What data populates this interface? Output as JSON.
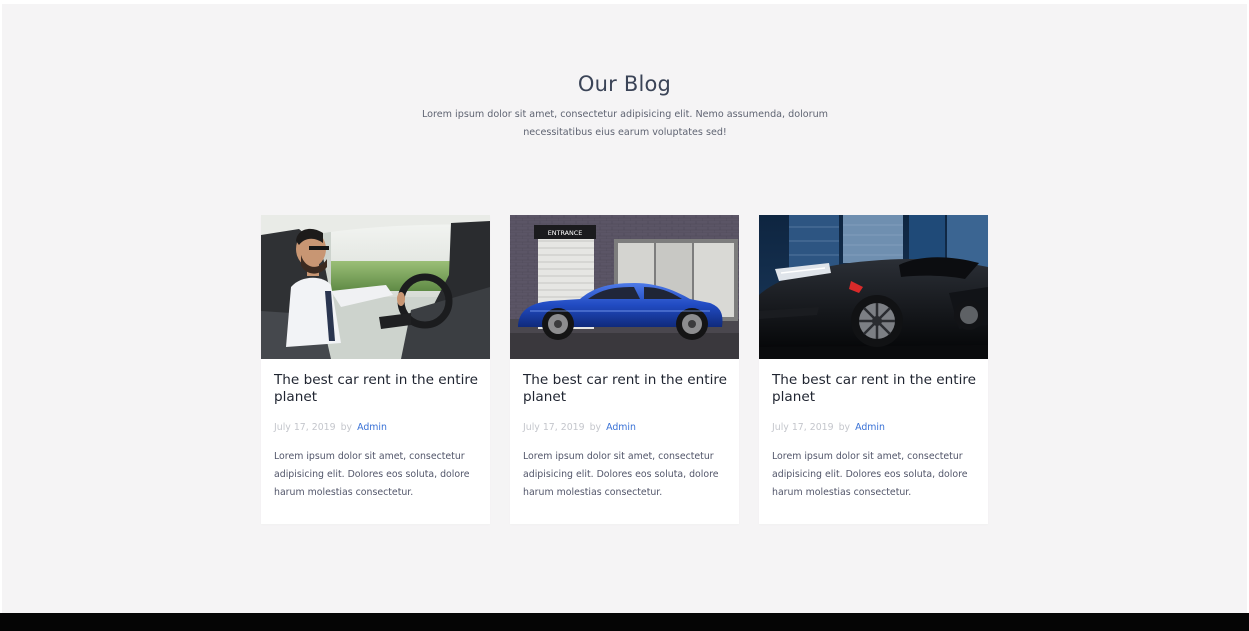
{
  "section": {
    "title": "Our Blog",
    "subtitle": "Lorem ipsum dolor sit amet, consectetur adipisicing elit. Nemo assumenda, dolorum necessitatibus eius earum voluptates sed!"
  },
  "posts": [
    {
      "title": "The best car rent in the entire planet",
      "date": "July 17, 2019",
      "by": "by",
      "author": "Admin",
      "excerpt": "Lorem ipsum dolor sit amet, consectetur adipisicing elit. Dolores eos soluta, dolore harum molestias consectetur.",
      "image_label": ""
    },
    {
      "title": "The best car rent in the entire planet",
      "date": "July 17, 2019",
      "by": "by",
      "author": "Admin",
      "excerpt": "Lorem ipsum dolor sit amet, consectetur adipisicing elit. Dolores eos soluta, dolore harum molestias consectetur.",
      "image_label": "ENTRANCE"
    },
    {
      "title": "The best car rent in the entire planet",
      "date": "July 17, 2019",
      "by": "by",
      "author": "Admin",
      "excerpt": "Lorem ipsum dolor sit amet, consectetur adipisicing elit. Dolores eos soluta, dolore harum molestias consectetur.",
      "image_label": ""
    }
  ],
  "colors": {
    "section_bg": "#f5f4f5",
    "heading": "#3b4457",
    "text": "#52566a",
    "meta": "#c4c6cc",
    "link": "#3a72d6",
    "footer": "#050505"
  }
}
